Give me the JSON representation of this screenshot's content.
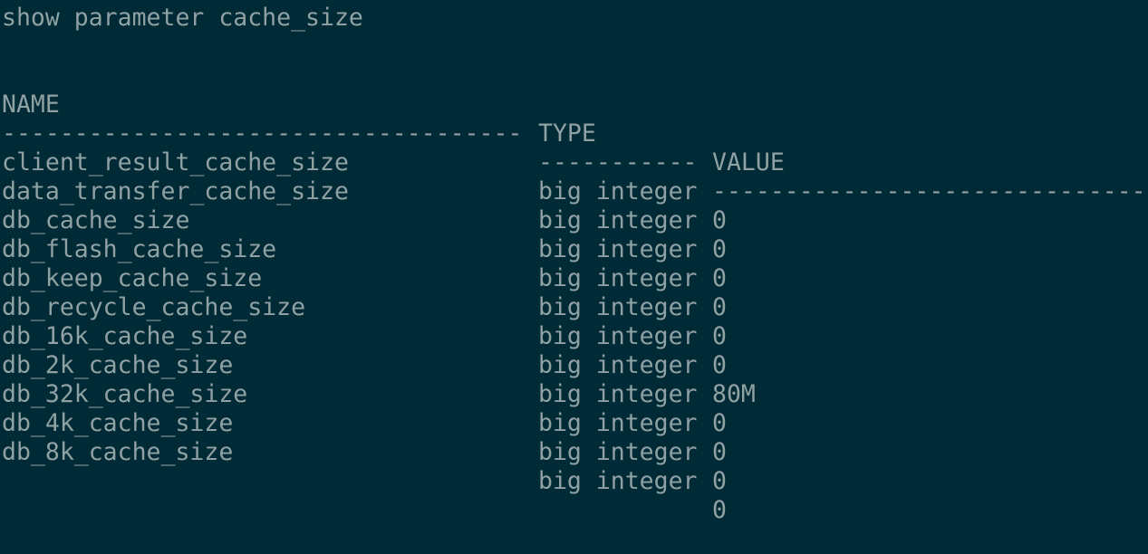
{
  "command": "show parameter cache_size",
  "headers": {
    "name": "NAME",
    "type": "TYPE",
    "value": "VALUE"
  },
  "separators": {
    "name": "------------------------------------",
    "type": "-----------",
    "value": "------------------------------"
  },
  "rows": [
    {
      "name": "client_result_cache_size",
      "type": "big integer",
      "value": "0"
    },
    {
      "name": "data_transfer_cache_size",
      "type": "big integer",
      "value": "0"
    },
    {
      "name": "db_cache_size",
      "type": "big integer",
      "value": "0"
    },
    {
      "name": "db_flash_cache_size",
      "type": "big integer",
      "value": "0"
    },
    {
      "name": "db_keep_cache_size",
      "type": "big integer",
      "value": "0"
    },
    {
      "name": "db_recycle_cache_size",
      "type": "big integer",
      "value": "0"
    },
    {
      "name": "db_16k_cache_size",
      "type": "big integer",
      "value": "80M"
    },
    {
      "name": "db_2k_cache_size",
      "type": "big integer",
      "value": "0"
    },
    {
      "name": "db_32k_cache_size",
      "type": "big integer",
      "value": "0"
    },
    {
      "name": "db_4k_cache_size",
      "type": "big integer",
      "value": "0"
    },
    {
      "name": "db_8k_cache_size",
      "type": "big integer",
      "value": "0"
    }
  ]
}
